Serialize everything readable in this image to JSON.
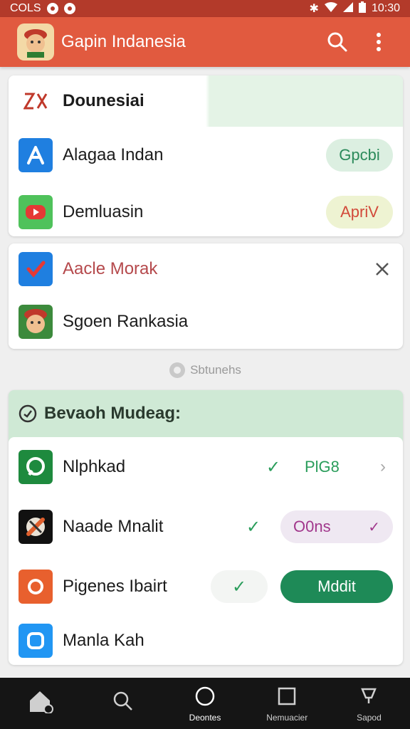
{
  "status_bar": {
    "left_text": "COLS",
    "time": "10:30"
  },
  "app_bar": {
    "title": "Gapin Indanesia"
  },
  "card1": {
    "header": {
      "title": "Dounesiai"
    },
    "rows": [
      {
        "label": "Alagaa Indan",
        "action": "Gpcbi"
      },
      {
        "label": "Demluasin",
        "action": "ApriV"
      }
    ]
  },
  "card2": {
    "rows": [
      {
        "label": "Aacle Morak"
      },
      {
        "label": "Sgoen Rankasia"
      }
    ]
  },
  "divider_label": "Sbtunehs",
  "section": {
    "title": "Bevaoh Mudeag:",
    "rows": [
      {
        "label": "Nlphkad",
        "value": "PlG8"
      },
      {
        "label": "Naade Mnalit",
        "value": "O0ns"
      },
      {
        "label": "Pigenes Ibairt",
        "value": "Mddit"
      },
      {
        "label": "Manla Kah"
      }
    ]
  },
  "bottom_nav": [
    {
      "label": ""
    },
    {
      "label": ""
    },
    {
      "label": "Deontes"
    },
    {
      "label": "Nemuacier"
    },
    {
      "label": "Sapod"
    }
  ],
  "colors": {
    "brand": "#e15a3f",
    "accent_green": "#1e8a57",
    "pill_green": "#dcefe1",
    "pill_yellow": "#eef3d2",
    "pill_purple": "#efe8f2"
  }
}
